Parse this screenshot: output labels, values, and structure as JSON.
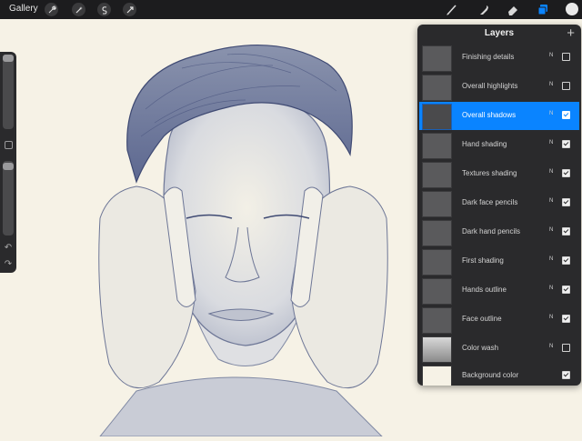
{
  "app": {
    "gallery_label": "Gallery"
  },
  "toolbar": {
    "left_tools": [
      "wrench-icon",
      "magic-wand-icon",
      "selection-icon",
      "transform-icon"
    ],
    "right_tools": [
      "brush-icon",
      "smudge-icon",
      "eraser-icon",
      "layers-icon"
    ],
    "active_color": "#e9e9e9",
    "accent": "#0a84ff"
  },
  "layers_panel": {
    "title": "Layers",
    "add_label": "+",
    "layers": [
      {
        "name": "Finishing details",
        "blend": "N",
        "visible": false,
        "selected": false
      },
      {
        "name": "Overall highlights",
        "blend": "N",
        "visible": false,
        "selected": false
      },
      {
        "name": "Overall shadows",
        "blend": "N",
        "visible": true,
        "selected": true
      },
      {
        "name": "Hand shading",
        "blend": "N",
        "visible": true,
        "selected": false
      },
      {
        "name": "Textures shading",
        "blend": "N",
        "visible": true,
        "selected": false
      },
      {
        "name": "Dark face pencils",
        "blend": "N",
        "visible": true,
        "selected": false
      },
      {
        "name": "Dark hand pencils",
        "blend": "N",
        "visible": true,
        "selected": false
      },
      {
        "name": "First shading",
        "blend": "N",
        "visible": true,
        "selected": false
      },
      {
        "name": "Hands outline",
        "blend": "N",
        "visible": true,
        "selected": false
      },
      {
        "name": "Face outline",
        "blend": "N",
        "visible": true,
        "selected": false
      },
      {
        "name": "Color wash",
        "blend": "N",
        "visible": false,
        "selected": false
      },
      {
        "name": "Background color",
        "blend": "",
        "visible": true,
        "selected": false
      }
    ]
  }
}
